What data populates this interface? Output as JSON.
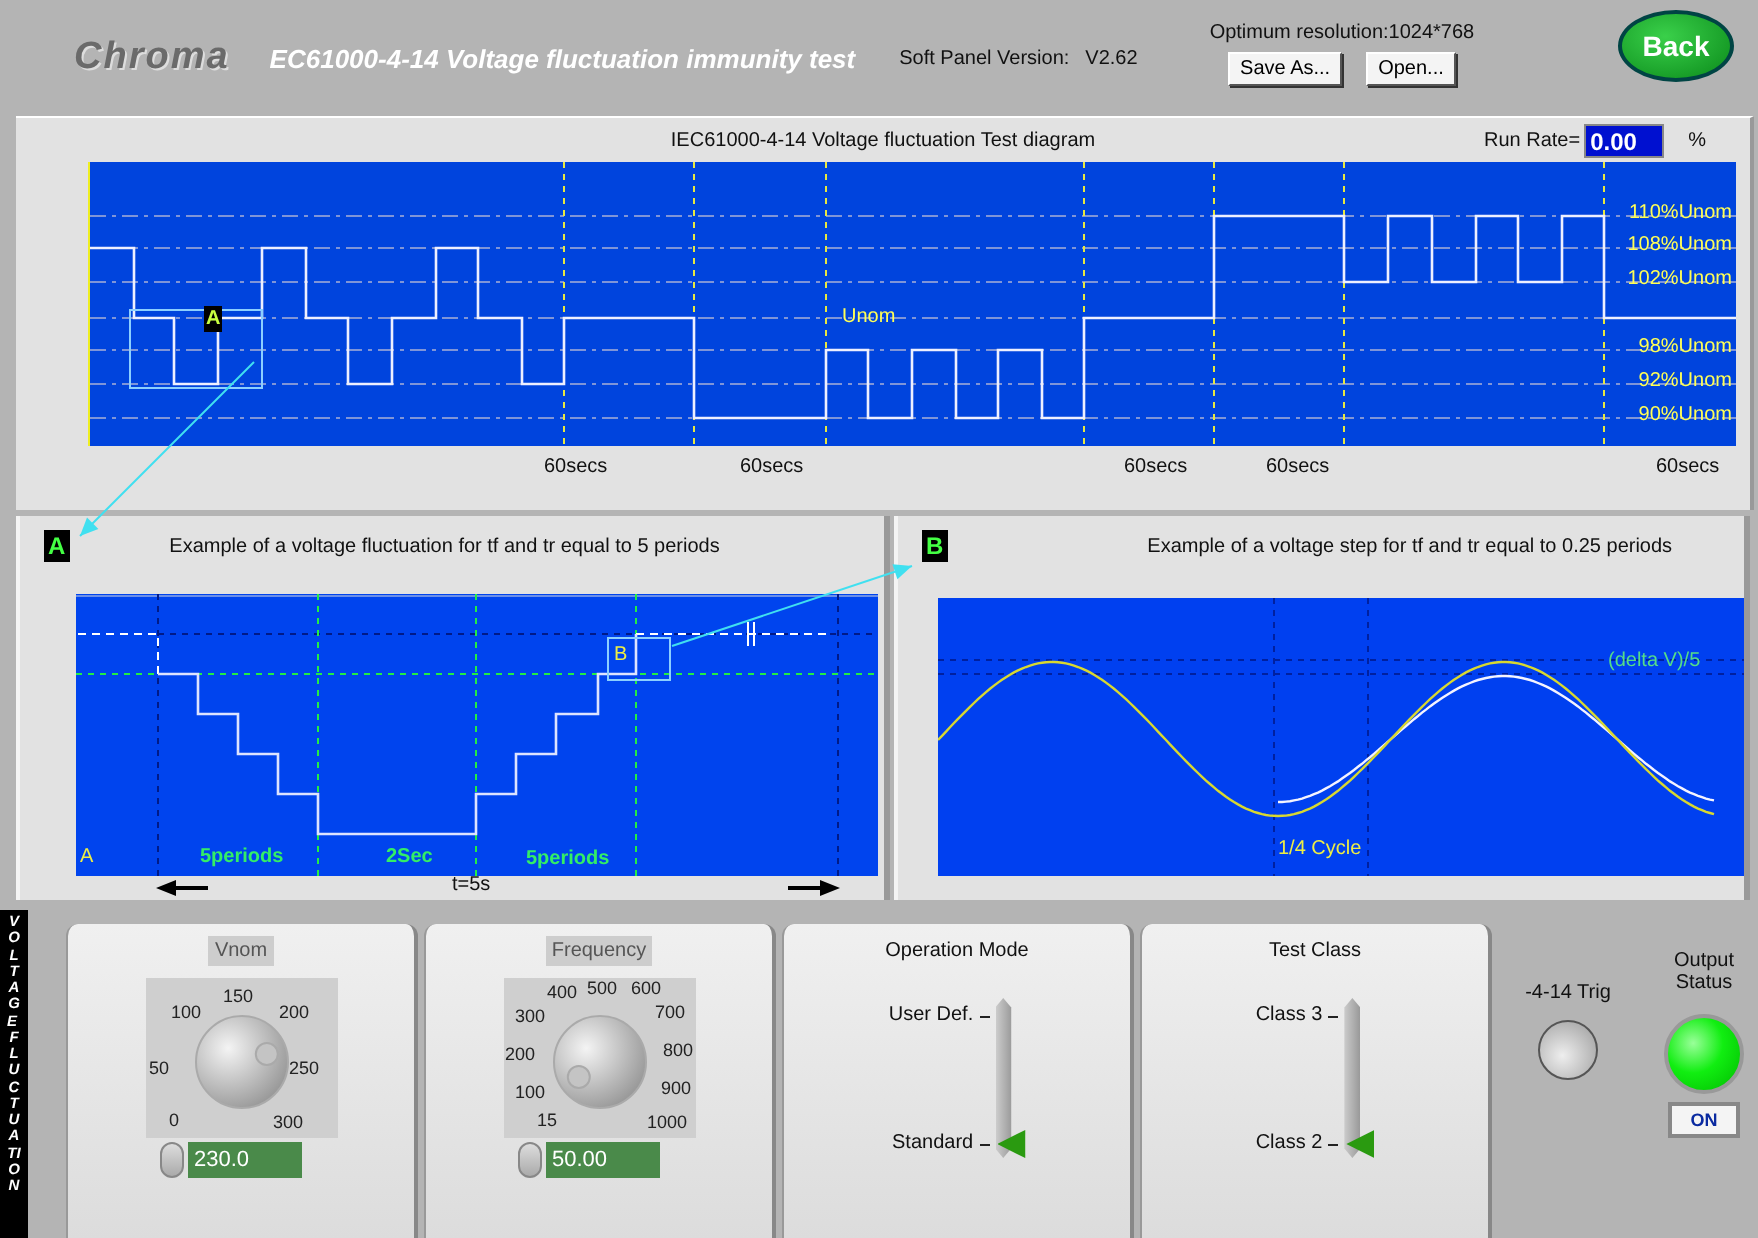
{
  "header": {
    "logo": "Chroma",
    "title": "EC61000-4-14 Voltage fluctuation immunity test",
    "version_label": "Soft Panel Version:",
    "version": "V2.62",
    "resolution_note": "Optimum resolution:1024*768",
    "buttons": [
      "Save As...",
      "Open..."
    ],
    "back_button": "Back"
  },
  "test_diagram": {
    "title": "IEC61000-4-14 Voltage fluctuation Test diagram",
    "run_rate": {
      "label": "Run Rate=",
      "value": "0.00",
      "unit": "%"
    },
    "level_labels": [
      "110%Unom",
      "108%Unom",
      "102%Unom",
      "98%Unom",
      "92%Unom",
      "90%Unom"
    ],
    "unom_label": "Unom",
    "detail_badge": "A",
    "duration_labels": [
      "60secs",
      "60secs",
      "60secs",
      "60secs",
      "60secs"
    ]
  },
  "example_a": {
    "badge": "A",
    "title": "Example of a voltage fluctuation for tf and tr equal to 5 periods",
    "corner_label": "A",
    "detail_badge": "B",
    "segment_labels": [
      "5periods",
      "2Sec",
      "5periods"
    ],
    "span_label": "t=5s"
  },
  "example_b": {
    "badge": "B",
    "title": "Example of a voltage step for tf and tr equal to 0.25 periods",
    "delta_label": "(delta V)/5",
    "cycle_label": "1/4 Cycle"
  },
  "side_label": "VOLTAGE FLUCTUATION",
  "controls": [
    {
      "kind": "knob",
      "label": "Vnom",
      "scale": [
        "0",
        "50",
        "100",
        "150",
        "200",
        "250",
        "300"
      ],
      "value": "230.0"
    },
    {
      "kind": "knob",
      "label": "Frequency",
      "scale": [
        "15",
        "100",
        "200",
        "300",
        "400",
        "500",
        "600",
        "700",
        "800",
        "900",
        "1000"
      ],
      "value": "50.00"
    },
    {
      "kind": "switch",
      "label": "Operation Mode",
      "options": [
        {
          "label": "User Def.",
          "selected": false
        },
        {
          "label": "Standard",
          "selected": true
        }
      ]
    },
    {
      "kind": "switch",
      "label": "Test Class",
      "options": [
        {
          "label": "Class 3",
          "selected": false
        },
        {
          "label": "Class 2",
          "selected": true
        }
      ]
    }
  ],
  "trigger": {
    "label": "-4-14 Trig"
  },
  "output_status": {
    "label": "Output Status",
    "on": true,
    "indicator": "ON"
  }
}
